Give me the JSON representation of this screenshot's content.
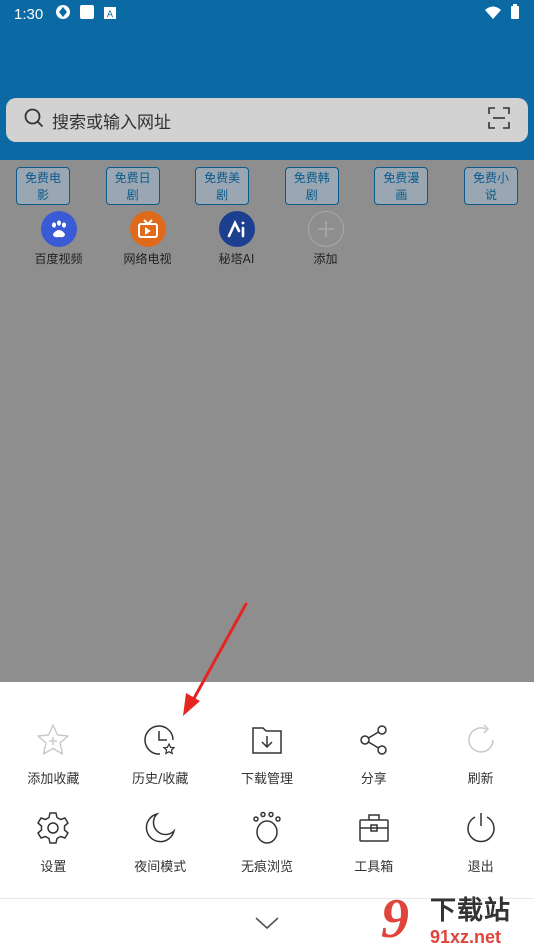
{
  "status": {
    "time": "1:30"
  },
  "search": {
    "placeholder": "搜索或输入网址"
  },
  "tags": [
    "免费电影",
    "免费日剧",
    "免费美剧",
    "免费韩剧",
    "免费漫画",
    "免费小说"
  ],
  "shortcuts": [
    {
      "label": "百度视频",
      "icon": "baidu-paw-icon",
      "color": "#3b5bd6"
    },
    {
      "label": "网络电视",
      "icon": "tv-icon",
      "color": "#e06a1c"
    },
    {
      "label": "秘塔AI",
      "icon": "metaso-icon",
      "color": "#1d3f8f"
    },
    {
      "label": "添加",
      "icon": "plus-icon",
      "color": "#9a9a9a"
    }
  ],
  "menu": [
    {
      "label": "添加收藏",
      "icon": "star-add-icon"
    },
    {
      "label": "历史/收藏",
      "icon": "history-star-icon"
    },
    {
      "label": "下载管理",
      "icon": "download-folder-icon"
    },
    {
      "label": "分享",
      "icon": "share-icon"
    },
    {
      "label": "刷新",
      "icon": "refresh-icon"
    },
    {
      "label": "设置",
      "icon": "gear-icon"
    },
    {
      "label": "夜间模式",
      "icon": "moon-icon"
    },
    {
      "label": "无痕浏览",
      "icon": "paw-icon"
    },
    {
      "label": "工具箱",
      "icon": "toolbox-icon"
    },
    {
      "label": "退出",
      "icon": "power-icon"
    }
  ],
  "watermark": {
    "big": "9",
    "line1": "下载站",
    "line2": "91xz.net"
  },
  "colors": {
    "header": "#0b6aa4",
    "overlay": "#8e8e8e",
    "arrow": "#e52620",
    "tag": "#0b5a8c"
  }
}
